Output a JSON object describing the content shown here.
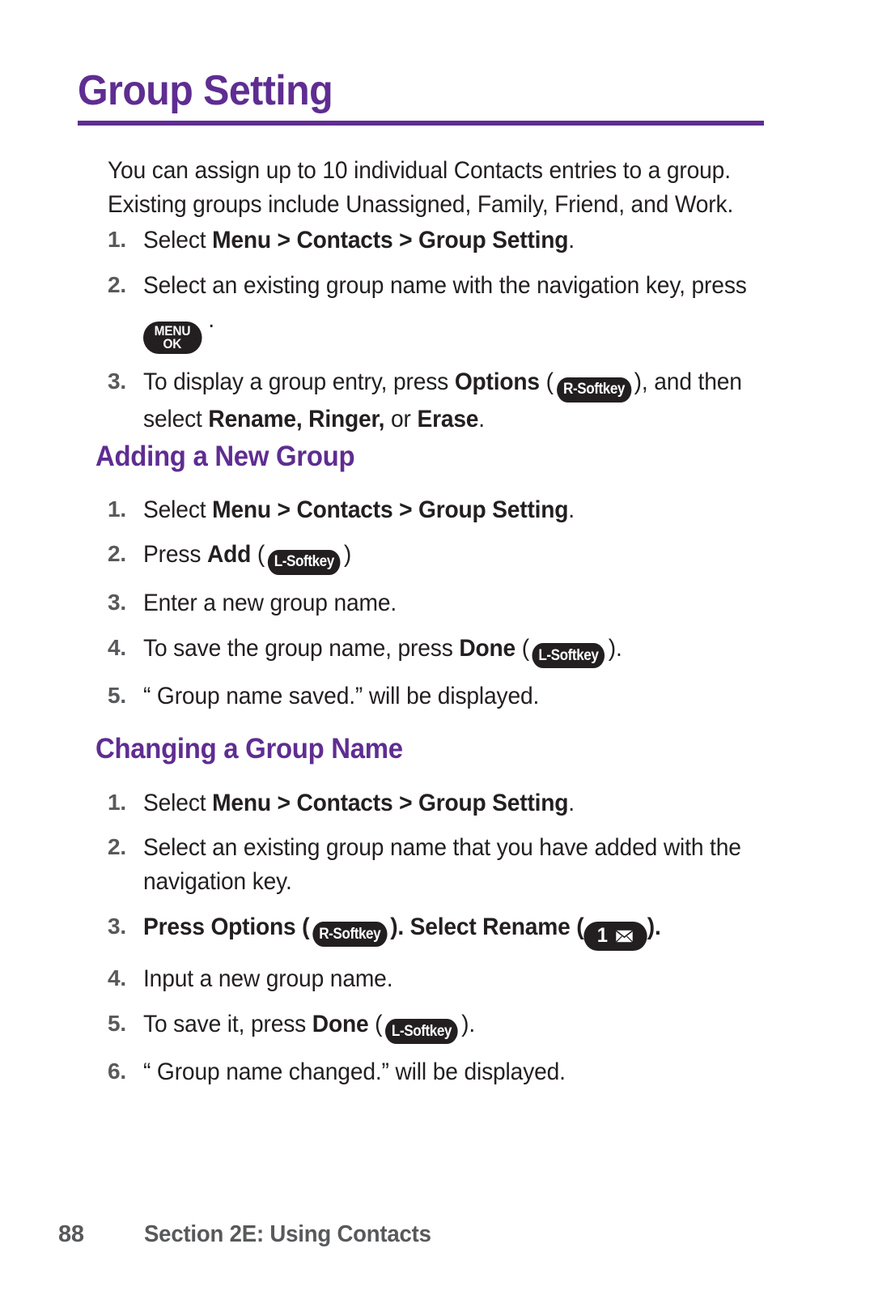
{
  "document": {
    "title": "Group Setting",
    "accent_color": "#5f2d91",
    "text_color": "#231f20",
    "muted_color": "#58595b",
    "intro": "You can assign up to 10 individual Contacts entries to a group. Existing groups include Unassigned, Family, Friend, and Work."
  },
  "steps_intro": [
    {
      "num": "1.",
      "parts": [
        {
          "t": "Select ",
          "b": false
        },
        {
          "t": "Menu > Contacts > Group Setting",
          "b": true
        },
        {
          "t": ".",
          "b": false
        }
      ]
    },
    {
      "num": "2.",
      "parts": [
        {
          "t": "Select an existing group name with the navigation key, press ",
          "b": false
        },
        {
          "key": "menu-ok",
          "line1": "MENU",
          "line2": "OK"
        },
        {
          "t": " .",
          "b": false
        }
      ]
    },
    {
      "num": "3.",
      "parts": [
        {
          "t": "To display a group entry, press ",
          "b": false
        },
        {
          "t": "Options",
          "b": true
        },
        {
          "t": " (",
          "b": false
        },
        {
          "key": "softkey",
          "label": "R-Softkey"
        },
        {
          "t": "), and then select ",
          "b": false
        },
        {
          "t": "Rename, Ringer,",
          "b": true
        },
        {
          "t": " or ",
          "b": false
        },
        {
          "t": "Erase",
          "b": true
        },
        {
          "t": ".",
          "b": false
        }
      ]
    }
  ],
  "section_adding": {
    "heading": "Adding a New Group",
    "steps": [
      {
        "num": "1.",
        "parts": [
          {
            "t": "Select ",
            "b": false
          },
          {
            "t": "Menu > Contacts > Group Setting",
            "b": true
          },
          {
            "t": ".",
            "b": false
          }
        ]
      },
      {
        "num": "2.",
        "parts": [
          {
            "t": "Press ",
            "b": false
          },
          {
            "t": "Add",
            "b": true
          },
          {
            "t": " (",
            "b": false
          },
          {
            "key": "softkey",
            "label": "L-Softkey"
          },
          {
            "t": ")",
            "b": false
          }
        ]
      },
      {
        "num": "3.",
        "parts": [
          {
            "t": "Enter a new group name.",
            "b": false
          }
        ]
      },
      {
        "num": "4.",
        "parts": [
          {
            "t": "To save the group name, press ",
            "b": false
          },
          {
            "t": "Done",
            "b": true
          },
          {
            "t": " (",
            "b": false
          },
          {
            "key": "softkey",
            "label": "L-Softkey"
          },
          {
            "t": ").",
            "b": false
          }
        ]
      },
      {
        "num": "5.",
        "parts": [
          {
            "t": "“ Group name saved.” will be displayed.",
            "b": false
          }
        ]
      }
    ]
  },
  "section_changing": {
    "heading": "Changing a Group Name",
    "steps": [
      {
        "num": "1.",
        "parts": [
          {
            "t": "Select ",
            "b": false
          },
          {
            "t": "Menu > Contacts > Group Setting",
            "b": true
          },
          {
            "t": ".",
            "b": false
          }
        ]
      },
      {
        "num": "2.",
        "parts": [
          {
            "t": "Select an existing group name that you have added with the navigation key.",
            "b": false
          }
        ]
      },
      {
        "num": "3.",
        "parts": [
          {
            "t": "Press ",
            "b": true
          },
          {
            "t": "Options",
            "b": true
          },
          {
            "t": " (",
            "b": true
          },
          {
            "key": "softkey",
            "label": "R-Softkey"
          },
          {
            "t": "). Select ",
            "b": true
          },
          {
            "t": "Rename",
            "b": true
          },
          {
            "t": " (",
            "b": true
          },
          {
            "key": "num-envelope",
            "digit": "1",
            "icon": "envelope-icon"
          },
          {
            "t": ").",
            "b": true
          }
        ]
      },
      {
        "num": "4.",
        "parts": [
          {
            "t": "Input a new group name.",
            "b": false
          }
        ]
      },
      {
        "num": "5.",
        "parts": [
          {
            "t": "To save it, press ",
            "b": false
          },
          {
            "t": "Done",
            "b": true
          },
          {
            "t": " (",
            "b": false
          },
          {
            "key": "softkey",
            "label": "L-Softkey"
          },
          {
            "t": ").",
            "b": false
          }
        ]
      },
      {
        "num": "6.",
        "parts": [
          {
            "t": "“ Group name changed.” will be displayed.",
            "b": false
          }
        ]
      }
    ]
  },
  "footer": {
    "page_number": "88",
    "section_label": "Section 2E: Using Contacts"
  }
}
